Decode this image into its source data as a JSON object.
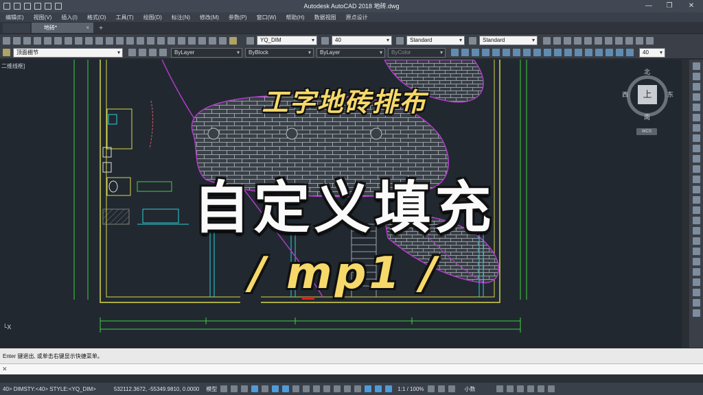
{
  "window": {
    "title": "Autodesk AutoCAD 2018    地砖.dwg",
    "minimize": "—",
    "maximize": "❐",
    "close": "✕"
  },
  "menu": [
    "编辑(E)",
    "视图(V)",
    "插入(I)",
    "格式(O)",
    "工具(T)",
    "绘图(D)",
    "标注(N)",
    "修改(M)",
    "参数(P)",
    "窗口(W)",
    "帮助(H)",
    "数据视图",
    "原点设计"
  ],
  "doc_tab": {
    "label": "地砖*",
    "close": "×",
    "add": "+"
  },
  "toolbar1": {
    "dim_style": "YQ_DIM",
    "dim_scale": "40",
    "text_style": "Standard",
    "table_style": "Standard"
  },
  "toolbar2": {
    "layer": "顶面棚节",
    "color": "ByLayer",
    "linetype": "ByBlock",
    "lineweight": "ByLayer",
    "plotstyle": "ByColor",
    "zoom_value": "40"
  },
  "viewport_label": "二维线框]",
  "viewcube": {
    "top": "上",
    "north": "北",
    "south": "南",
    "east": "东",
    "west": "西",
    "wcs": "WCS"
  },
  "overlay": {
    "line1": "工字地砖排布",
    "line2": "自定义填充",
    "line3": "/ mp1 /"
  },
  "ucs_symbol": "└X",
  "command": {
    "history": "Enter 键退出, 或单击右键显示快捷菜单。",
    "close": "✕"
  },
  "status": {
    "dim_info": "40> DIMSTY:<40> STYLE:<YQ_DIM>",
    "coords": "532112.3672, -55349.9810, 0.0000",
    "model": "模型",
    "scale": "1:1 / 100%",
    "units": "小数"
  },
  "colors": {
    "background": "#212830",
    "wall": "#d7d84a",
    "arc": "#b13bc8",
    "hatch": "#b9bfc5",
    "cyan": "#2fd0d8",
    "green": "#3ed23e",
    "caption_yellow": "#f6d96a"
  }
}
